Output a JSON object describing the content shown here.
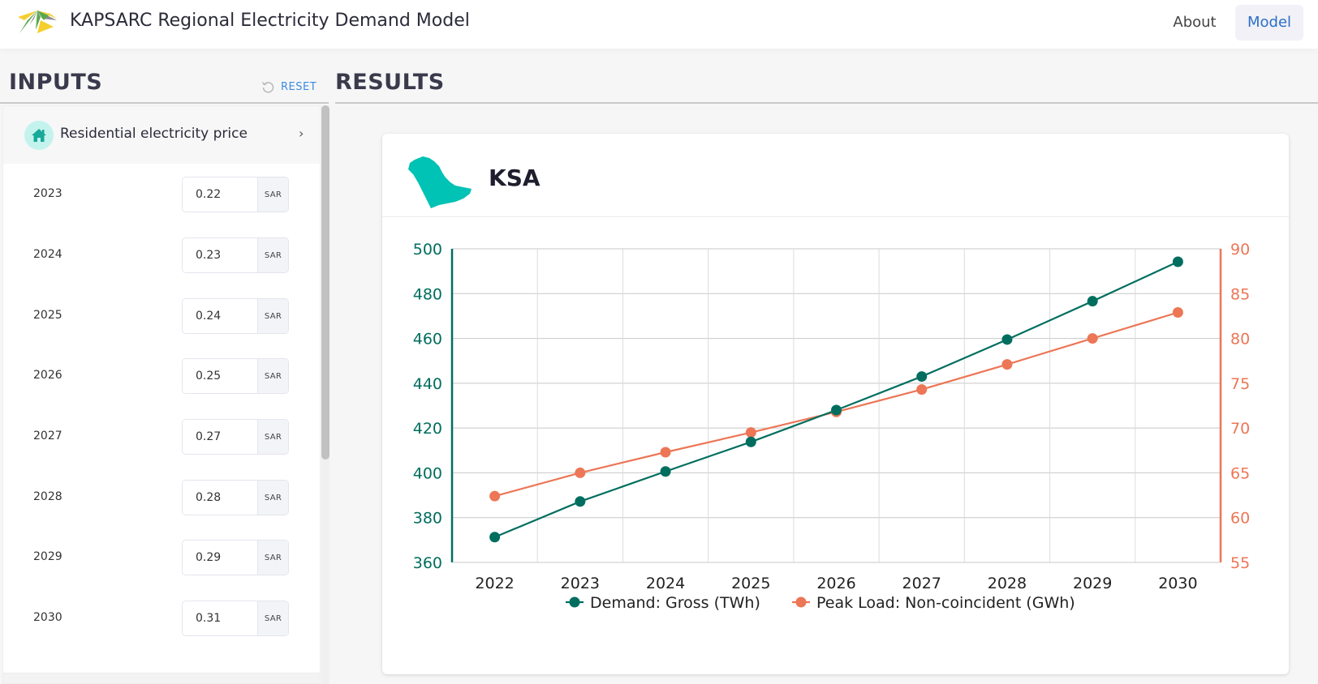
{
  "header": {
    "app_title": "KAPSARC Regional Electricity Demand Model",
    "logo_icon": "kapsarc-logo-icon",
    "nav": [
      {
        "label": "About",
        "active": false
      },
      {
        "label": "Model",
        "active": true
      }
    ]
  },
  "inputs": {
    "heading": "INPUTS",
    "reset_label": "RESET",
    "reset_icon": "reset-icon",
    "accordion": {
      "title": "Residential electricity price",
      "icon": "house-icon",
      "expand_icon": "chevron-right-icon",
      "rows": [
        {
          "year": "2023",
          "value": "0.22",
          "unit": "SAR"
        },
        {
          "year": "2024",
          "value": "0.23",
          "unit": "SAR"
        },
        {
          "year": "2025",
          "value": "0.24",
          "unit": "SAR"
        },
        {
          "year": "2026",
          "value": "0.25",
          "unit": "SAR"
        },
        {
          "year": "2027",
          "value": "0.27",
          "unit": "SAR"
        },
        {
          "year": "2028",
          "value": "0.28",
          "unit": "SAR"
        },
        {
          "year": "2029",
          "value": "0.29",
          "unit": "SAR"
        },
        {
          "year": "2030",
          "value": "0.31",
          "unit": "SAR"
        }
      ]
    }
  },
  "results": {
    "heading": "RESULTS",
    "region": "KSA",
    "region_icon": "ksa-map-icon"
  },
  "colors": {
    "demand": "#006e5f",
    "peak": "#ec7656",
    "accent_blue": "#2c6fc7",
    "house_badge": "#c4f3ee",
    "house_icon": "#18a999",
    "ksa_map": "#00c2b5"
  },
  "chart_data": {
    "type": "line",
    "title": "",
    "x": [
      "2022",
      "2023",
      "2024",
      "2025",
      "2026",
      "2027",
      "2028",
      "2029",
      "2030"
    ],
    "series": [
      {
        "name": "Demand: Gross (TWh)",
        "axis": "left",
        "color": "#006e5f",
        "values": [
          371.3,
          387.2,
          400.6,
          413.8,
          428.0,
          443.0,
          459.5,
          476.6,
          494.2
        ]
      },
      {
        "name": "Peak Load: Non-coincident (GWh)",
        "axis": "right",
        "color": "#ec7656",
        "values": [
          62.4,
          65.0,
          67.3,
          69.5,
          71.8,
          74.3,
          77.1,
          80.0,
          82.9
        ]
      }
    ],
    "y_left": {
      "min": 360,
      "max": 500,
      "ticks": [
        "360",
        "380",
        "400",
        "420",
        "440",
        "460",
        "480",
        "500"
      ],
      "color": "#006e5f"
    },
    "y_right": {
      "min": 55,
      "max": 90,
      "ticks": [
        "55",
        "60",
        "65",
        "70",
        "75",
        "80",
        "85",
        "90"
      ],
      "color": "#ec7656"
    },
    "xlabel": "",
    "ylabel": "",
    "grid": true,
    "legend": "bottom-center"
  }
}
